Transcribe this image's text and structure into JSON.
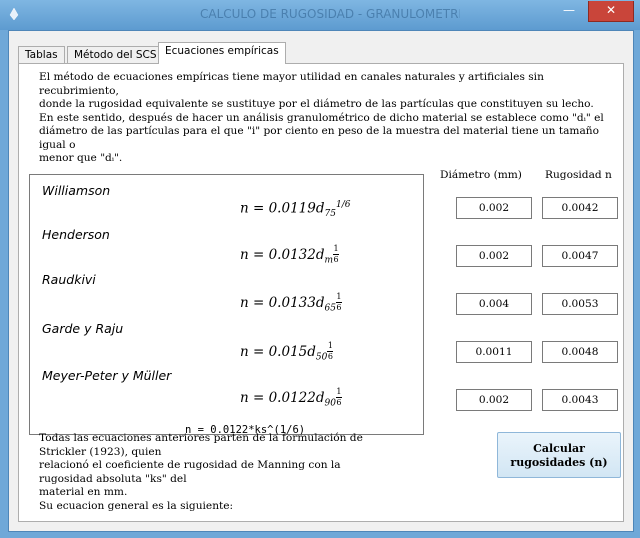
{
  "window": {
    "title": "CALCULO DE RUGOSIDAD - GRANULOMETRIA",
    "close_label": "✕",
    "minimize_label": "—"
  },
  "tabs": [
    {
      "label": "Tablas",
      "active": false
    },
    {
      "label": "Método del SCS",
      "active": false
    },
    {
      "label": "Ecuaciones empíricas",
      "active": true
    }
  ],
  "intro_text": "El método de ecuaciones empíricas tiene mayor utilidad en canales naturales y artificiales sin recubrimiento,\ndonde la rugosidad equivalente se sustituye por el diámetro de las partículas que constituyen su lecho.\nEn este sentido, después de hacer un análisis granulométrico de dicho material se establece como \"dᵢ\" el\ndiámetro de las partículas para el que \"i\" por ciento en peso de la muestra del material tiene un tamaño igual o\nmenor que \"dᵢ\".",
  "columns": {
    "diameter": "Diámetro (mm)",
    "roughness": "Rugosidad n"
  },
  "equations": [
    {
      "name": "Williamson",
      "coef": "0.0119",
      "sub": "75",
      "exp_num": "1",
      "exp_den": "6",
      "exp_style": "slash",
      "diameter": "0.002",
      "roughness": "0.0042"
    },
    {
      "name": "Henderson",
      "coef": "0.0132",
      "sub": "m",
      "exp_num": "1",
      "exp_den": "6",
      "exp_style": "frac",
      "diameter": "0.002",
      "roughness": "0.0047"
    },
    {
      "name": "Raudkivi",
      "coef": "0.0133",
      "sub": "65",
      "exp_num": "1",
      "exp_den": "6",
      "exp_style": "frac",
      "diameter": "0.004",
      "roughness": "0.0053"
    },
    {
      "name": "Garde y Raju",
      "coef": "0.015",
      "sub": "50",
      "exp_num": "1",
      "exp_den": "6",
      "exp_style": "frac",
      "diameter": "0.0011",
      "roughness": "0.0048"
    },
    {
      "name": "Meyer-Peter y Müller",
      "coef": "0.0122",
      "sub": "90",
      "exp_num": "1",
      "exp_den": "6",
      "exp_style": "frac",
      "diameter": "0.002",
      "roughness": "0.0043"
    }
  ],
  "formula_prefix": "n = ",
  "formula_d": "d",
  "outro_text": "Todas las ecuaciones anteriores parten de la formulación de Strickler (1923), quien\nrelacionó el coeficiente de rugosidad de Manning con la rugosidad absoluta \"ks\" del\nmaterial en mm.\nSu ecuacion general es la siguiente:",
  "general_formula": "n = 0.0122*ks^(1/6)",
  "calc_button": "Calcular\nrugosidades (n)"
}
